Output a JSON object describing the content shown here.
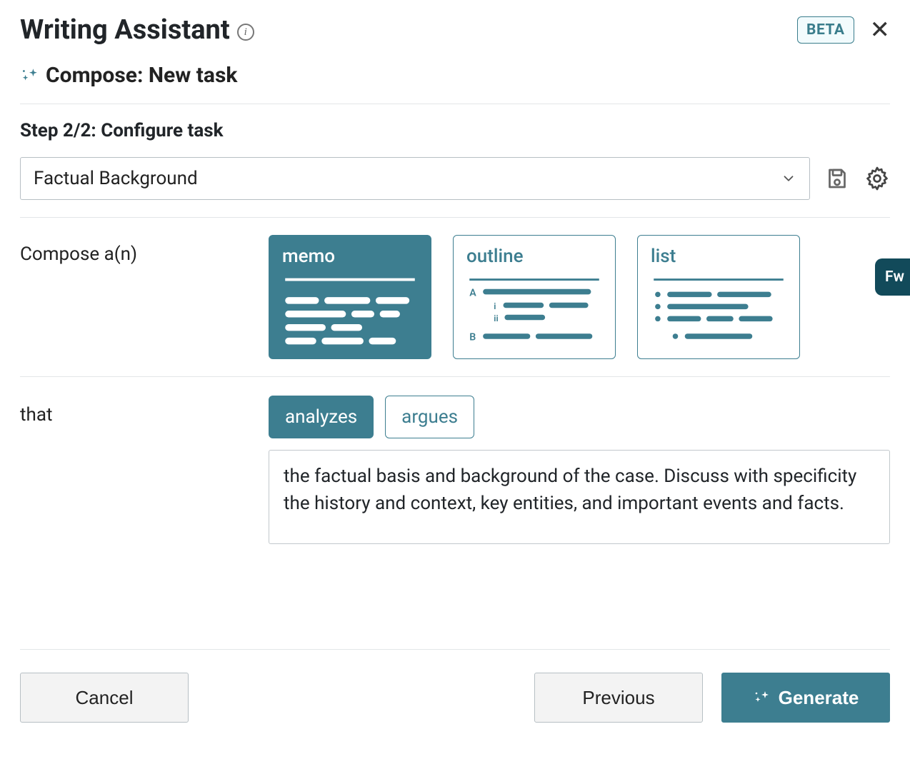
{
  "header": {
    "title": "Writing Assistant",
    "beta_badge": "BETA"
  },
  "subheader": {
    "label": "Compose: New task"
  },
  "step": {
    "label": "Step 2/2: Configure task"
  },
  "task_select": {
    "value": "Factual Background"
  },
  "compose": {
    "label": "Compose a(n)",
    "options": {
      "memo": "memo",
      "outline": "outline",
      "list": "list"
    }
  },
  "that": {
    "label": "that",
    "chips": {
      "analyzes": "analyzes",
      "argues": "argues"
    },
    "description": "the factual basis and background of the case. Discuss with specificity the history and context, key entities, and important events and facts."
  },
  "side_tab": {
    "label": "Fw"
  },
  "footer": {
    "cancel": "Cancel",
    "previous": "Previous",
    "generate": "Generate"
  },
  "colors": {
    "accent": "#3d7e90",
    "dark_accent": "#124a5a"
  }
}
